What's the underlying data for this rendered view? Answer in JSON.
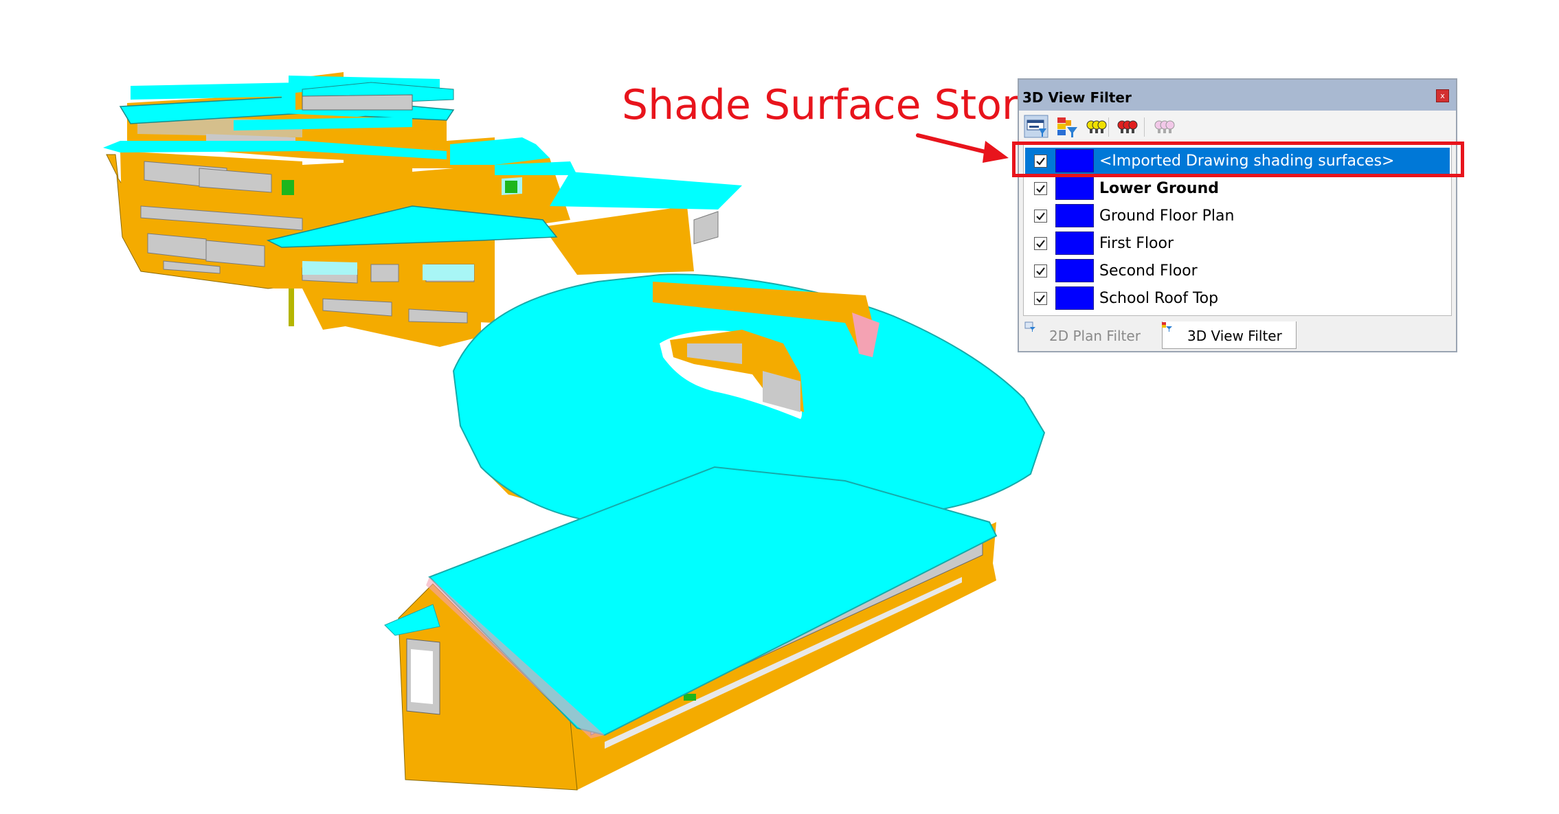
{
  "annotation": {
    "text": "Shade Surface Storey",
    "color": "#e8141c"
  },
  "panel": {
    "title": "3D View Filter",
    "close_label": "x",
    "toolbar": [
      {
        "name": "filter-settings-icon"
      },
      {
        "name": "color-filter-icon"
      },
      {
        "name": "show-all-icon"
      },
      {
        "name": "hide-all-icon"
      },
      {
        "name": "reset-view-icon"
      }
    ],
    "items": [
      {
        "label": "<Imported Drawing shading surfaces>",
        "checked": true,
        "selected": true,
        "bold": false,
        "color": "#0000ff"
      },
      {
        "label": "Lower Ground",
        "checked": true,
        "selected": false,
        "bold": true,
        "color": "#0000ff"
      },
      {
        "label": "Ground Floor Plan",
        "checked": true,
        "selected": false,
        "bold": false,
        "color": "#0000ff"
      },
      {
        "label": "First Floor",
        "checked": true,
        "selected": false,
        "bold": false,
        "color": "#0000ff"
      },
      {
        "label": "Second Floor",
        "checked": true,
        "selected": false,
        "bold": false,
        "color": "#0000ff"
      },
      {
        "label": "School Roof Top",
        "checked": true,
        "selected": false,
        "bold": false,
        "color": "#0000ff"
      }
    ],
    "tabs": [
      {
        "label": "2D Plan Filter",
        "active": false
      },
      {
        "label": "3D View Filter",
        "active": true
      }
    ]
  },
  "colors": {
    "roof": "#00ffff",
    "wall": "#f4ab00",
    "selection": "#0078d7",
    "highlight": "#e8141c"
  }
}
